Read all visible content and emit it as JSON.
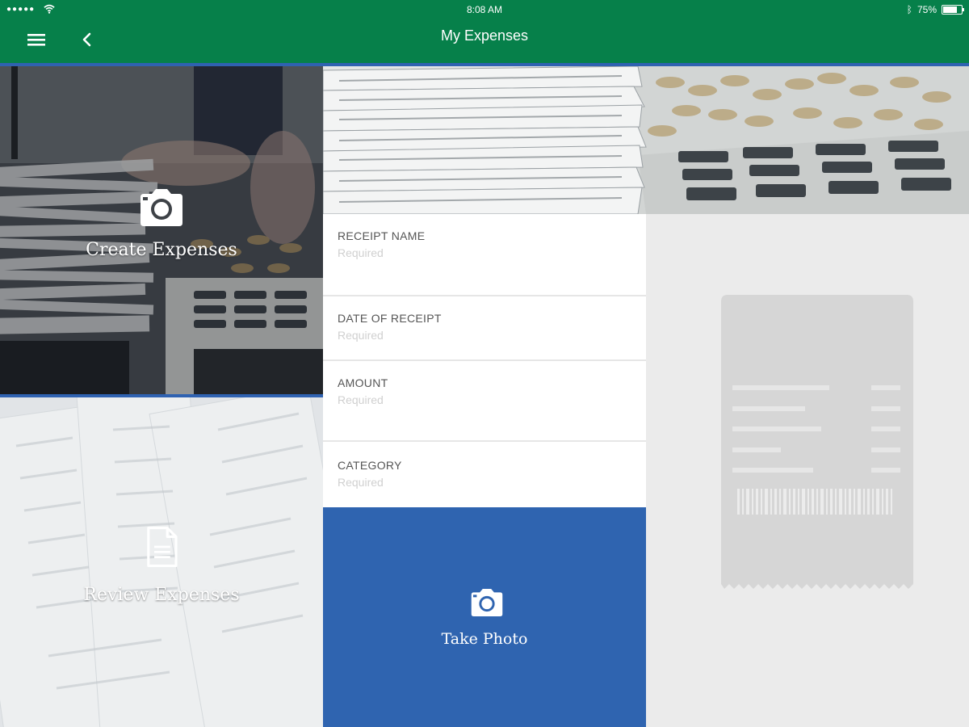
{
  "status_bar": {
    "signal": "●●●●●",
    "time": "8:08 AM",
    "battery_text": "75%",
    "battery_level": 0.75
  },
  "header": {
    "title": "My Expenses",
    "menu_icon": "hamburger-menu-icon",
    "back_icon": "chevron-left-icon",
    "bar_color": "#06804a",
    "accent_color": "#2f62b1"
  },
  "tiles": [
    {
      "label": "Create Expenses",
      "icon": "camera-icon"
    },
    {
      "label": "Review Expenses",
      "icon": "document-icon"
    }
  ],
  "form": {
    "fields": [
      {
        "label": "RECEIPT NAME",
        "placeholder": "Required",
        "value": ""
      },
      {
        "label": "DATE OF RECEIPT",
        "placeholder": "Required",
        "value": ""
      },
      {
        "label": "AMOUNT",
        "placeholder": "Required",
        "value": ""
      },
      {
        "label": "CATEGORY",
        "placeholder": "Required",
        "value": ""
      }
    ],
    "take_photo": {
      "label": "Take Photo",
      "icon": "camera-icon",
      "color": "#2f64b0"
    }
  },
  "preview": {
    "icon": "receipt-placeholder-icon"
  }
}
